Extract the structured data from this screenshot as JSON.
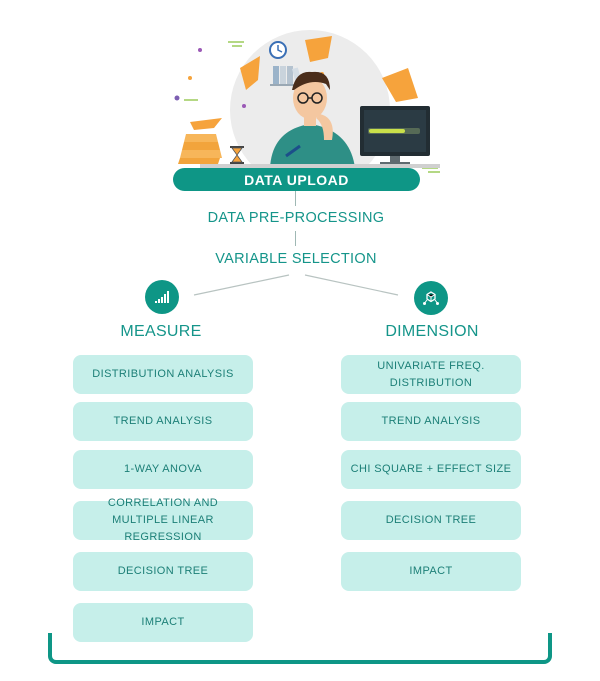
{
  "flow": {
    "upload_label": "DATA UPLOAD",
    "preprocessing_label": "DATA PRE-PROCESSING",
    "selection_label": "VARIABLE SELECTION"
  },
  "measure": {
    "title": "MEASURE",
    "icon": "bar-chart-icon",
    "items": [
      "DISTRIBUTION ANALYSIS",
      "TREND ANALYSIS",
      "1-WAY ANOVA",
      "CORRELATION AND MULTIPLE LINEAR REGRESSION",
      "DECISION TREE",
      "IMPACT"
    ]
  },
  "dimension": {
    "title": "DIMENSION",
    "icon": "cube-network-icon",
    "items": [
      "UNIVARIATE FREQ. DISTRIBUTION",
      "TREND ANALYSIS",
      "CHI SQUARE + EFFECT SIZE",
      "DECISION TREE",
      "IMPACT"
    ]
  },
  "colors": {
    "teal": "#0e9686",
    "box_fill": "#c6efea",
    "text_teal": "#15958a",
    "accent_orange": "#f6a33c"
  }
}
